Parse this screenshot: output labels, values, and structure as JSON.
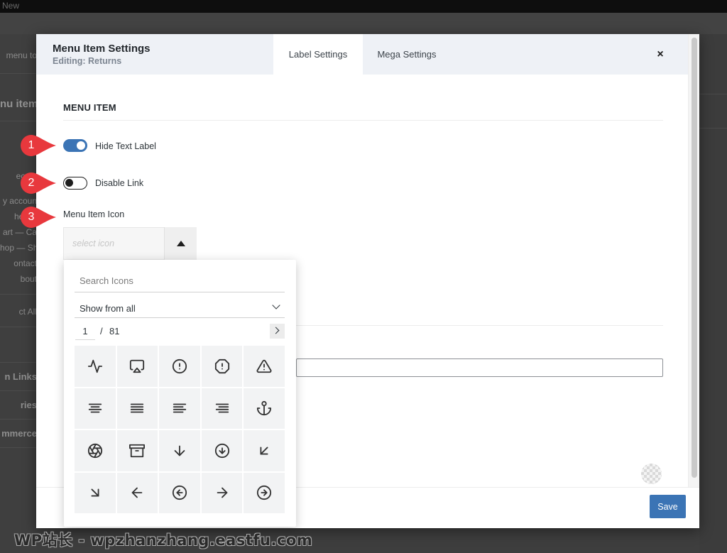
{
  "background": {
    "topbar_label": "New",
    "sidebar_fragments": [
      {
        "text": "menu to",
        "style": "normal"
      },
      {
        "text": "nu item",
        "style": "heading"
      },
      {
        "text": "ecent",
        "style": "normal"
      },
      {
        "text": "y accoun",
        "style": "normal"
      },
      {
        "text": "hecko",
        "style": "normal"
      },
      {
        "text": "art — Ca",
        "style": "normal"
      },
      {
        "text": "hop — Sh",
        "style": "normal"
      },
      {
        "text": "ontact",
        "style": "normal"
      },
      {
        "text": "bout",
        "style": "normal"
      },
      {
        "text": "ct All",
        "style": "normal"
      },
      {
        "text": "n Links",
        "style": "bold"
      },
      {
        "text": "ries",
        "style": "bold"
      },
      {
        "text": "mmerce",
        "style": "bold"
      }
    ]
  },
  "modal": {
    "title": "Menu Item Settings",
    "subtitle": "Editing: Returns",
    "tabs": [
      {
        "label": "Label Settings",
        "active": true
      },
      {
        "label": "Mega Settings",
        "active": false
      }
    ],
    "close_label": "×",
    "section_title": "MENU ITEM",
    "toggles": [
      {
        "label": "Hide Text Label",
        "on": true
      },
      {
        "label": "Disable Link",
        "on": false
      }
    ],
    "icon_field_label": "Menu Item Icon",
    "icon_select_placeholder": "select icon",
    "save_label": "Save"
  },
  "icon_picker": {
    "search_placeholder": "Search Icons",
    "filter_value": "Show from all",
    "page_current": "1",
    "page_separator": "/",
    "page_total": "81",
    "icons": [
      "activity-icon",
      "airplay-icon",
      "alert-circle-icon",
      "alert-octagon-icon",
      "alert-triangle-icon",
      "align-center-icon",
      "align-justify-icon",
      "align-left-icon",
      "align-right-icon",
      "anchor-icon",
      "aperture-icon",
      "archive-icon",
      "arrow-down-icon",
      "arrow-down-circle-icon",
      "arrow-down-left-icon",
      "arrow-down-right-icon",
      "arrow-left-icon",
      "arrow-left-circle-icon",
      "arrow-right-icon",
      "arrow-right-circle-icon"
    ]
  },
  "annotations": [
    {
      "number": "1",
      "color": "#e8383d"
    },
    {
      "number": "2",
      "color": "#e8383d"
    },
    {
      "number": "3",
      "color": "#e8383d"
    }
  ],
  "watermark": "WP站长 - wpzhanzhang.eastfu.com",
  "colors": {
    "accent": "#3b74b5",
    "header_bg": "#eef1f6",
    "annotation": "#e8383d"
  }
}
